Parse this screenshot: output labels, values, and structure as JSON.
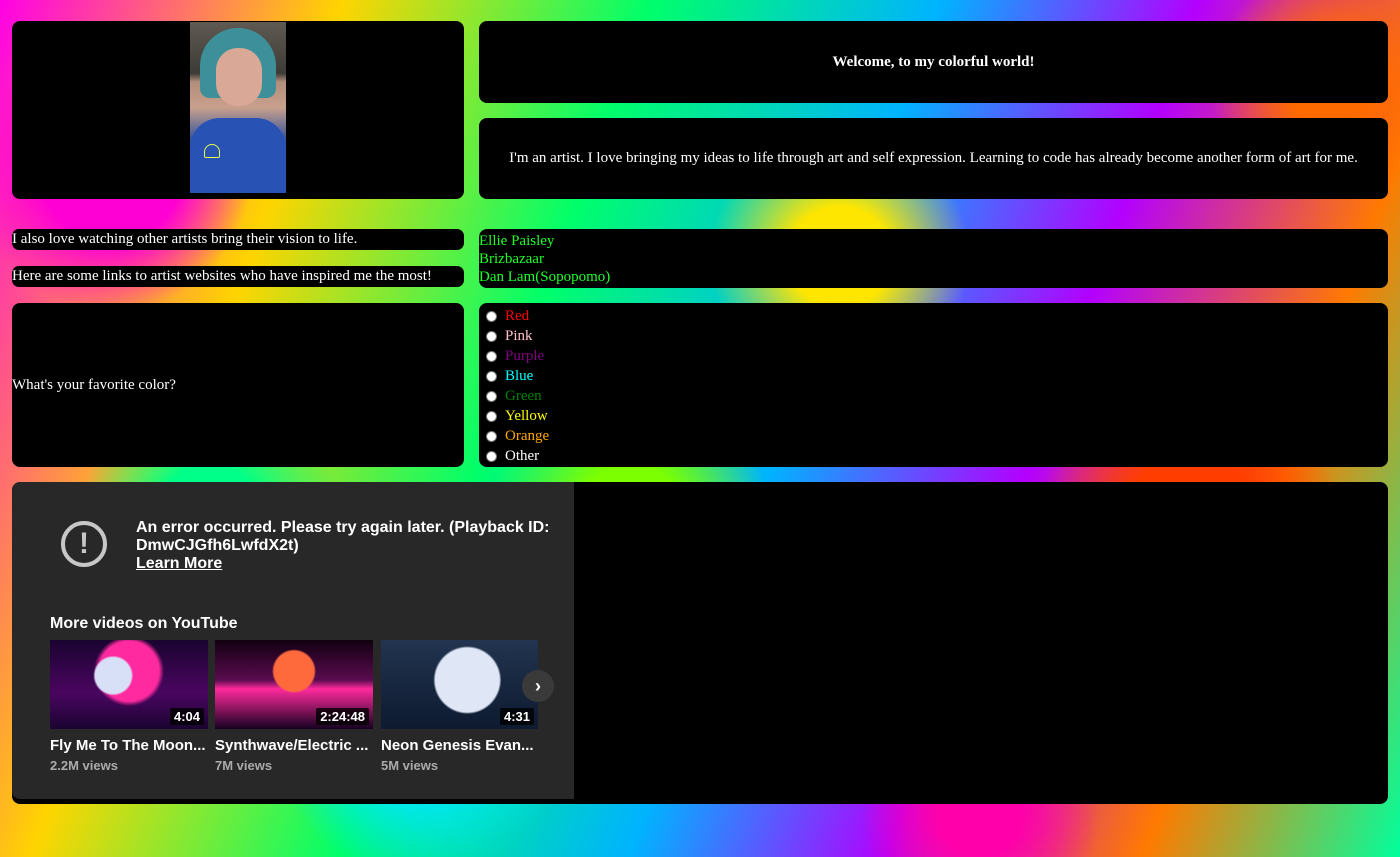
{
  "welcome": "Welcome, to my colorful world!",
  "bio": "I'm an artist. I love bringing my ideas to life through art and self expression. Learning to code has already become another form of art for me.",
  "artists_intro": "I also love watching other artists bring their vision to life.",
  "links_intro": "Here are some links to artist websites who have inspired me the most!",
  "links": [
    {
      "label": "Ellie Paisley"
    },
    {
      "label": "Brizbazaar"
    },
    {
      "label": "Dan Lam(Sopopomo)"
    }
  ],
  "link_color": "#1eff2a",
  "question": "What's your favorite color?",
  "colors": [
    {
      "label": "Red",
      "color": "#ff0000"
    },
    {
      "label": "Pink",
      "color": "#ffc0cb"
    },
    {
      "label": "Purple",
      "color": "#800080"
    },
    {
      "label": "Blue",
      "color": "#00ffff"
    },
    {
      "label": "Green",
      "color": "#008000"
    },
    {
      "label": "Yellow",
      "color": "#ffff00"
    },
    {
      "label": "Orange",
      "color": "#ffa500"
    },
    {
      "label": "Other",
      "color": "#ffffff"
    }
  ],
  "video": {
    "error_line1": "An error occurred. Please try again later. (Playback ID:",
    "error_line2": "DmwCJGfh6LwfdX2t)",
    "learn_more": "Learn More",
    "more_videos": "More videos on YouTube",
    "videos": [
      {
        "title": "Fly Me To The Moon...",
        "views": "2.2M views",
        "duration": "4:04"
      },
      {
        "title": "Synthwave/Electric ...",
        "views": "7M views",
        "duration": "2:24:48"
      },
      {
        "title": "Neon Genesis Evan...",
        "views": "5M views",
        "duration": "4:31"
      }
    ],
    "next_icon": "chevron-right-icon"
  }
}
